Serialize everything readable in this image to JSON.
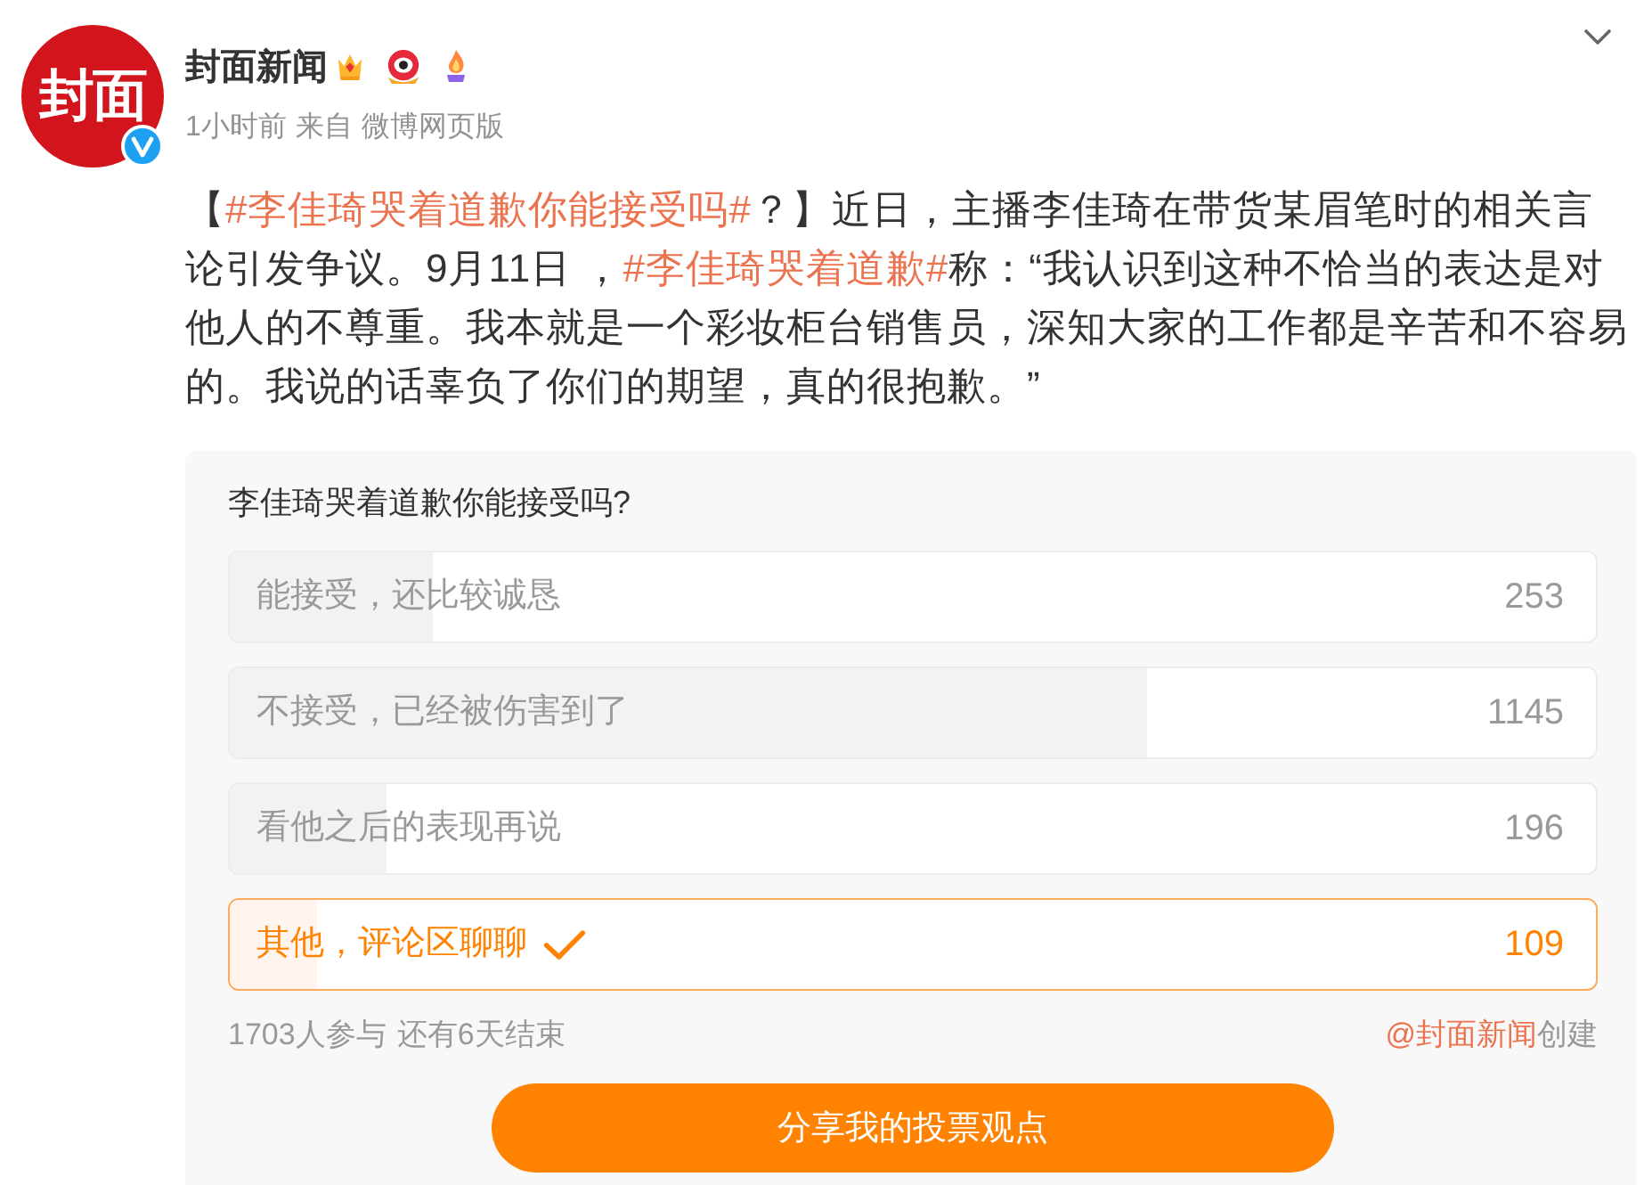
{
  "author": {
    "avatar_text": "封面",
    "verified": true,
    "name": "封面新闻",
    "time": "1小时前",
    "source_prefix": "来自",
    "source": "微博网页版"
  },
  "post": {
    "segments": [
      {
        "kind": "text",
        "text": "【"
      },
      {
        "kind": "topic",
        "text": "#李佳琦哭着道歉你能接受吗#"
      },
      {
        "kind": "text",
        "text": "？】近日，主播李佳琦在带货某眉笔时的相关言论引发争议。9月11日 ，"
      },
      {
        "kind": "topic",
        "text": "#李佳琦哭着道歉#"
      },
      {
        "kind": "text",
        "text": "称：“我认识到这种不恰当的表达是对他人的不尊重。我本就是一个彩妆柜台销售员，深知大家的工作都是辛苦和不容易的。我说的话辜负了你们的期望，真的很抱歉。”"
      }
    ]
  },
  "poll": {
    "title": "李佳琦哭着道歉你能接受吗?",
    "options": [
      {
        "label": "能接受，还比较诚恳",
        "votes": "253",
        "level": 0.149,
        "selected": false
      },
      {
        "label": "不接受，已经被伤害到了",
        "votes": "1145",
        "level": 0.672,
        "selected": false
      },
      {
        "label": "看他之后的表现再说",
        "votes": "196",
        "level": 0.115,
        "selected": false
      },
      {
        "label": "其他，评论区聊聊",
        "votes": "109",
        "level": 0.064,
        "selected": true
      }
    ],
    "participants": "1703人参与",
    "remaining": "还有6天结束",
    "creator": "@封面新闻",
    "creator_suffix": "创建",
    "share_button": "分享我的投票观点"
  }
}
